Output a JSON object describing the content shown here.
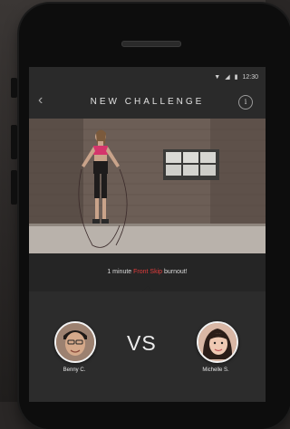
{
  "status_bar": {
    "time": "12:30"
  },
  "header": {
    "back_icon": "chevron-left-icon",
    "title": "NEW CHALLENGE",
    "info_label": "i"
  },
  "challenge": {
    "caption_pre": "1 minute ",
    "caption_highlight": "Front Skip",
    "caption_post": " burnout!",
    "accent_color": "#e23c3c"
  },
  "versus": {
    "player1": {
      "name": "Benny C."
    },
    "vs_label": "VS",
    "player2": {
      "name": "Michelle S."
    }
  }
}
